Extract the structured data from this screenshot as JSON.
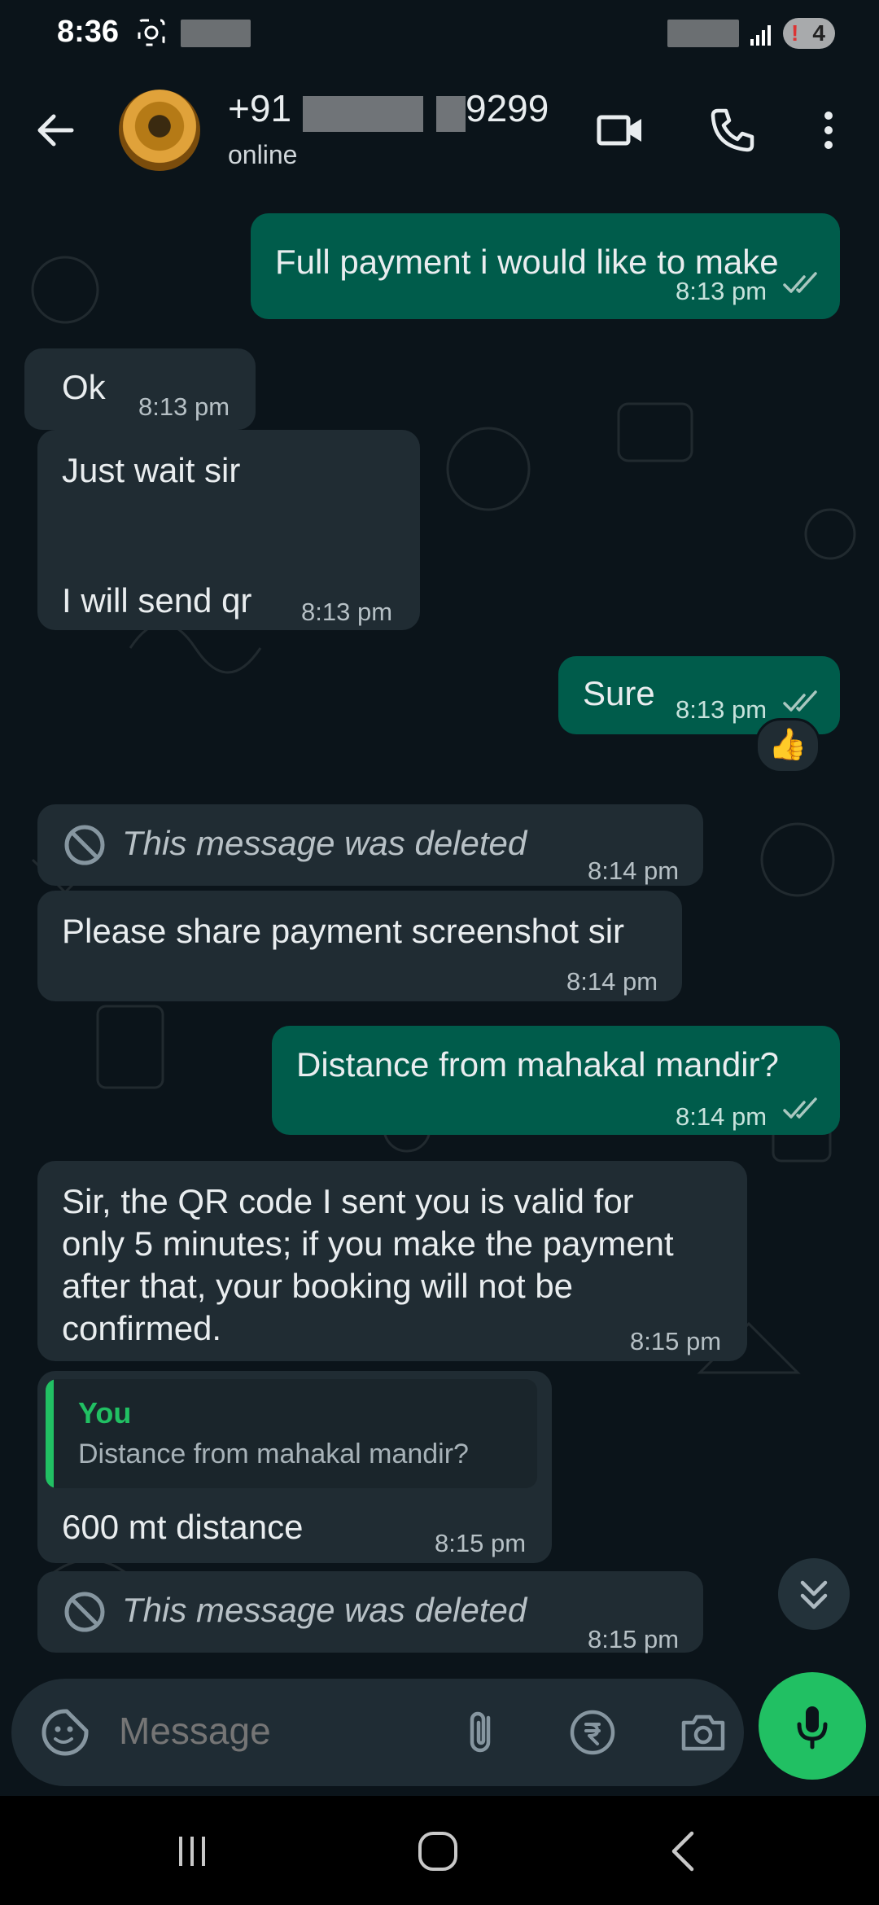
{
  "status_bar": {
    "time": "8:36",
    "battery": "4"
  },
  "header": {
    "contact_prefix": "+91",
    "contact_suffix": "9299",
    "status": "online"
  },
  "messages": [
    {
      "type": "out",
      "text": "Full payment i would like to make",
      "time": "8:13 pm"
    },
    {
      "type": "in",
      "text": "Ok",
      "time": "8:13 pm"
    },
    {
      "type": "in",
      "line1": "Just wait sir",
      "line2": "I will send qr",
      "time": "8:13 pm"
    },
    {
      "type": "out",
      "text": "Sure",
      "time": "8:13 pm",
      "reaction": "👍"
    },
    {
      "type": "in",
      "text": "This message was deleted",
      "time": "8:14 pm",
      "deleted": true
    },
    {
      "type": "in",
      "text": "Please share payment screenshot sir",
      "time": "8:14 pm"
    },
    {
      "type": "out",
      "text": "Distance from mahakal mandir?",
      "time": "8:14 pm"
    },
    {
      "type": "in",
      "lines": [
        "Sir, the QR code I sent you is valid for",
        "only 5 minutes; if you make the payment",
        "after that, your booking will not be",
        "confirmed."
      ],
      "time": "8:15 pm"
    },
    {
      "type": "in",
      "quote_author": "You",
      "quote_text": "Distance from mahakal mandir?",
      "text": "600 mt distance",
      "time": "8:15 pm"
    },
    {
      "type": "in",
      "text": "This message was deleted",
      "time": "8:15 pm",
      "deleted": true
    }
  ],
  "composer": {
    "placeholder": "Message"
  },
  "colors": {
    "accent": "#21c063",
    "outgoing_bubble": "#005c4b",
    "incoming_bubble": "#202c33",
    "background": "#0b141a"
  }
}
